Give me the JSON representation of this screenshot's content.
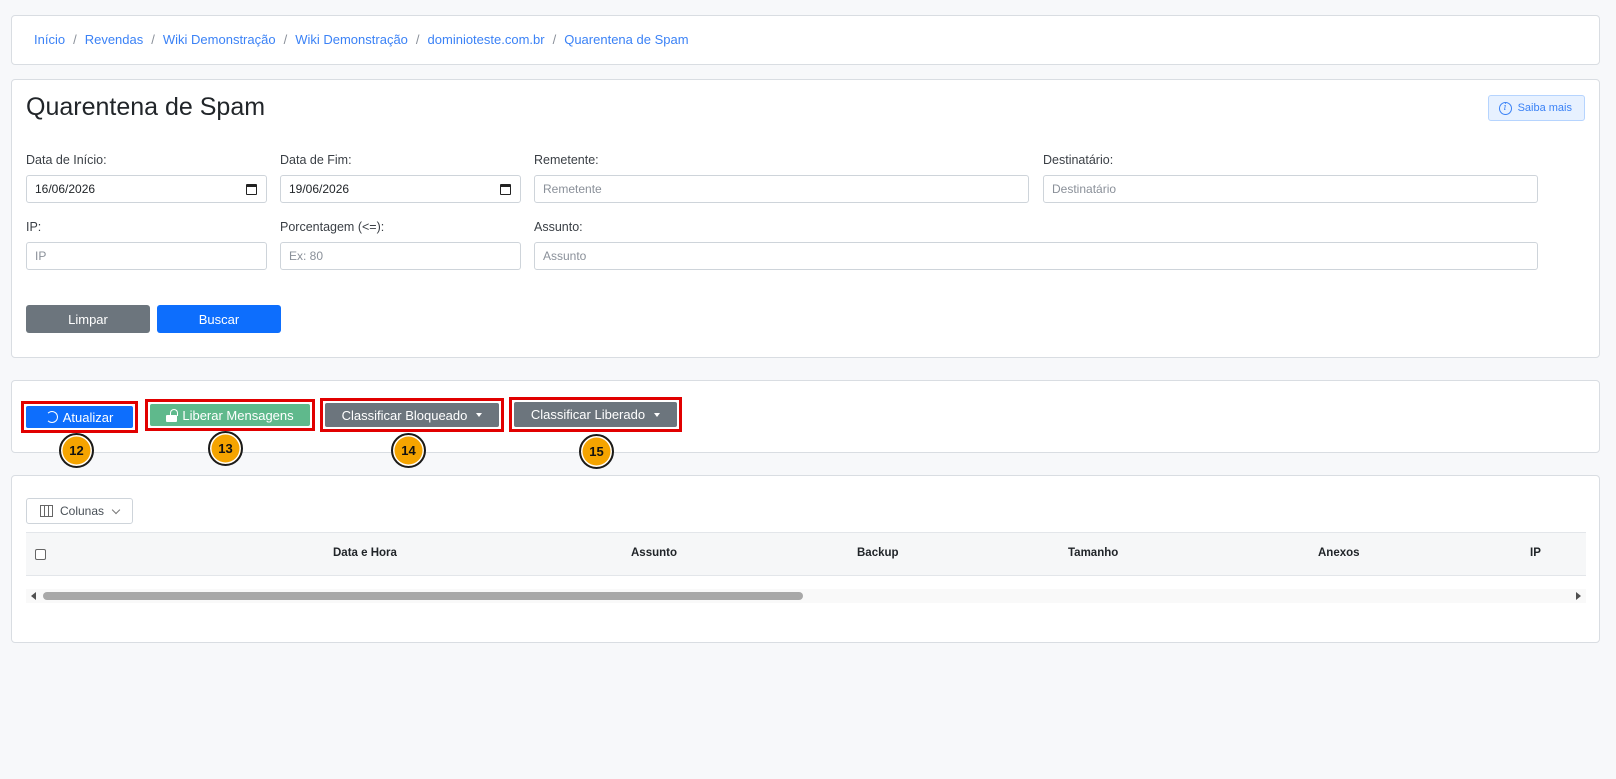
{
  "breadcrumb": {
    "items": [
      "Início",
      "Revendas",
      "Wiki Demonstração",
      "Wiki Demonstração",
      "dominioteste.com.br",
      "Quarentena de Spam"
    ],
    "separator": "/"
  },
  "page": {
    "title": "Quarentena de Spam",
    "help_label": "Saiba mais"
  },
  "filters": {
    "start_date": {
      "label": "Data de Início:",
      "value": "16/06/2026"
    },
    "end_date": {
      "label": "Data de Fim:",
      "value": "19/06/2026"
    },
    "sender": {
      "label": "Remetente:",
      "placeholder": "Remetente"
    },
    "recipient": {
      "label": "Destinatário:",
      "placeholder": "Destinatário"
    },
    "ip": {
      "label": "IP:",
      "placeholder": "IP"
    },
    "percentage": {
      "label": "Porcentagem (<=):",
      "placeholder": "Ex: 80"
    },
    "subject": {
      "label": "Assunto:",
      "placeholder": "Assunto"
    },
    "clear_label": "Limpar",
    "search_label": "Buscar"
  },
  "actions": {
    "refresh_label": "Atualizar",
    "release_label": "Liberar Mensagens",
    "classify_blocked_label": "Classificar Bloqueado",
    "classify_released_label": "Classificar Liberado"
  },
  "annotations": [
    "12",
    "13",
    "14",
    "15"
  ],
  "table": {
    "columns_button": "Colunas",
    "headers": [
      "Data e Hora",
      "Assunto",
      "Backup",
      "Tamanho",
      "Anexos",
      "IP"
    ]
  },
  "colors": {
    "primary": "#0d6efd",
    "secondary": "#6c757d",
    "success": "#5fb98c",
    "highlight": "#e10000",
    "badge": "#f5a400",
    "link": "#3b82f6"
  }
}
